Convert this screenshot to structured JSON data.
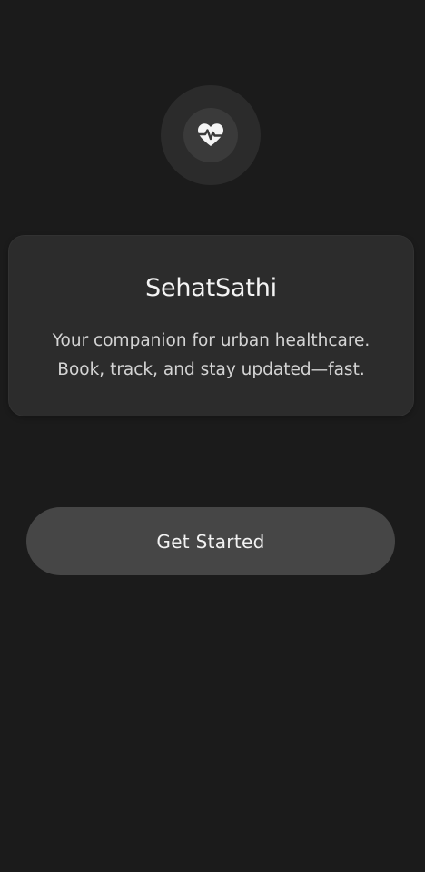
{
  "app": {
    "logo_icon": "heart-pulse-icon",
    "title": "SehatSathi",
    "tagline_line1": "Your companion for urban healthcare.",
    "tagline_line2": "Book, track, and stay updated—fast."
  },
  "actions": {
    "get_started_label": "Get Started"
  },
  "colors": {
    "background": "#1b1b1b",
    "card": "#2c2c2c",
    "button": "#464646",
    "logo_outer": "#2b2b2b",
    "logo_inner": "#3a3a3a",
    "text_primary": "#f4f4f4",
    "text_secondary": "#d4d4d4"
  }
}
